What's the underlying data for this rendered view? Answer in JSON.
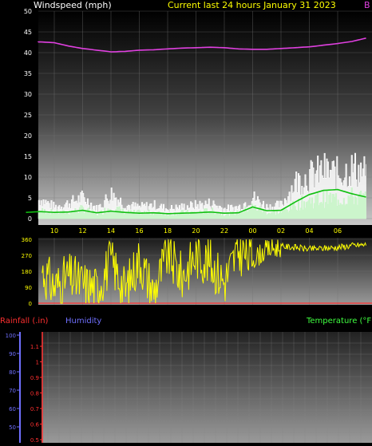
{
  "header": {
    "ylabel": "Windspeed (mph)",
    "title": "Current last 24 hours January 31 2023",
    "right_marker": "B"
  },
  "colors": {
    "background": "#000000",
    "barometer": "#e040e0",
    "wind_gust": "#ffffff",
    "wind_avg": "#c8f5c8",
    "wind_trend": "#10c010",
    "direction": "#ffff00",
    "rain": "#ff3030",
    "humidity": "#7070ff",
    "temperature": "#40ff40",
    "title": "#ffff00",
    "axis_text": "#ffffff"
  },
  "bottom_panel": {
    "rain_label": "Rainfall (.in)",
    "humidity_label": "Humidity",
    "temperature_label": "Temperature (°F)"
  },
  "chart_data": [
    {
      "type": "line",
      "title": "Current last 24 hours January 31 2023",
      "ylabel": "Windspeed (mph)",
      "ylim": [
        0,
        50
      ],
      "yticks": [
        0,
        5,
        10,
        15,
        20,
        25,
        30,
        35,
        40,
        45,
        50
      ],
      "xticks": [
        "10",
        "12",
        "14",
        "16",
        "18",
        "20",
        "22",
        "00",
        "02",
        "04",
        "06"
      ],
      "x_hours": [
        8,
        9,
        10,
        11,
        12,
        13,
        14,
        15,
        16,
        17,
        18,
        19,
        20,
        21,
        22,
        23,
        24,
        25,
        26,
        27,
        28,
        29,
        30,
        31,
        32
      ],
      "grid": true,
      "series": [
        {
          "values": [
            42.5,
            42.6,
            42.4,
            41.6,
            41.0,
            40.6,
            40.2,
            40.3,
            40.6,
            40.7,
            40.9,
            41.1,
            41.2,
            41.3,
            41.2,
            40.9,
            40.8,
            40.8,
            41.0,
            41.2,
            41.4,
            41.8,
            42.2,
            42.7,
            43.5
          ]
        },
        {
          "values": [
            3.5,
            5.0,
            3.0,
            4.0,
            5.5,
            2.5,
            6.5,
            3.5,
            3.0,
            3.5,
            2.5,
            3.0,
            3.5,
            4.0,
            2.5,
            3.0,
            5.5,
            3.0,
            3.5,
            9.5,
            11.0,
            12.5,
            11.5,
            13.0,
            12.0
          ]
        },
        {
          "values": [
            1.5,
            2.0,
            1.5,
            1.5,
            2.5,
            1.0,
            3.0,
            1.5,
            1.5,
            1.5,
            1.0,
            1.5,
            1.5,
            2.0,
            1.0,
            1.5,
            3.0,
            1.5,
            1.5,
            3.5,
            4.5,
            5.0,
            5.0,
            5.5,
            5.0
          ]
        },
        {
          "values": [
            1.5,
            1.7,
            1.5,
            1.6,
            2.0,
            1.4,
            1.8,
            1.5,
            1.3,
            1.4,
            1.2,
            1.3,
            1.4,
            1.6,
            1.3,
            1.4,
            2.8,
            1.9,
            2.0,
            4.0,
            5.8,
            6.8,
            7.0,
            6.0,
            5.2
          ]
        }
      ]
    },
    {
      "type": "line",
      "ylim": [
        0,
        360
      ],
      "yticks": [
        0,
        90,
        180,
        270,
        360
      ],
      "x_hours": [
        8,
        9,
        10,
        11,
        12,
        13,
        14,
        15,
        16,
        17,
        18,
        19,
        20,
        21,
        22,
        23,
        24,
        25,
        26,
        27,
        28,
        29,
        30,
        31,
        32
      ],
      "series": [
        {
          "values": [
            120,
            200,
            90,
            150,
            110,
            80,
            240,
            70,
            250,
            60,
            280,
            150,
            270,
            230,
            120,
            300,
            250,
            300,
            320,
            315,
            305,
            310,
            315,
            325,
            330
          ]
        }
      ]
    },
    {
      "type": "line",
      "ylabel_left": "Rainfall (.in)",
      "ylabel_left2": "Humidity",
      "ylabel_right": "Temperature (°F)",
      "humidity_ticks_visible": [
        50,
        60,
        70,
        80,
        90,
        100
      ],
      "rain_ticks_visible": [
        0.5,
        0.6,
        0.7,
        0.8,
        0.9,
        1,
        1.1
      ]
    }
  ]
}
